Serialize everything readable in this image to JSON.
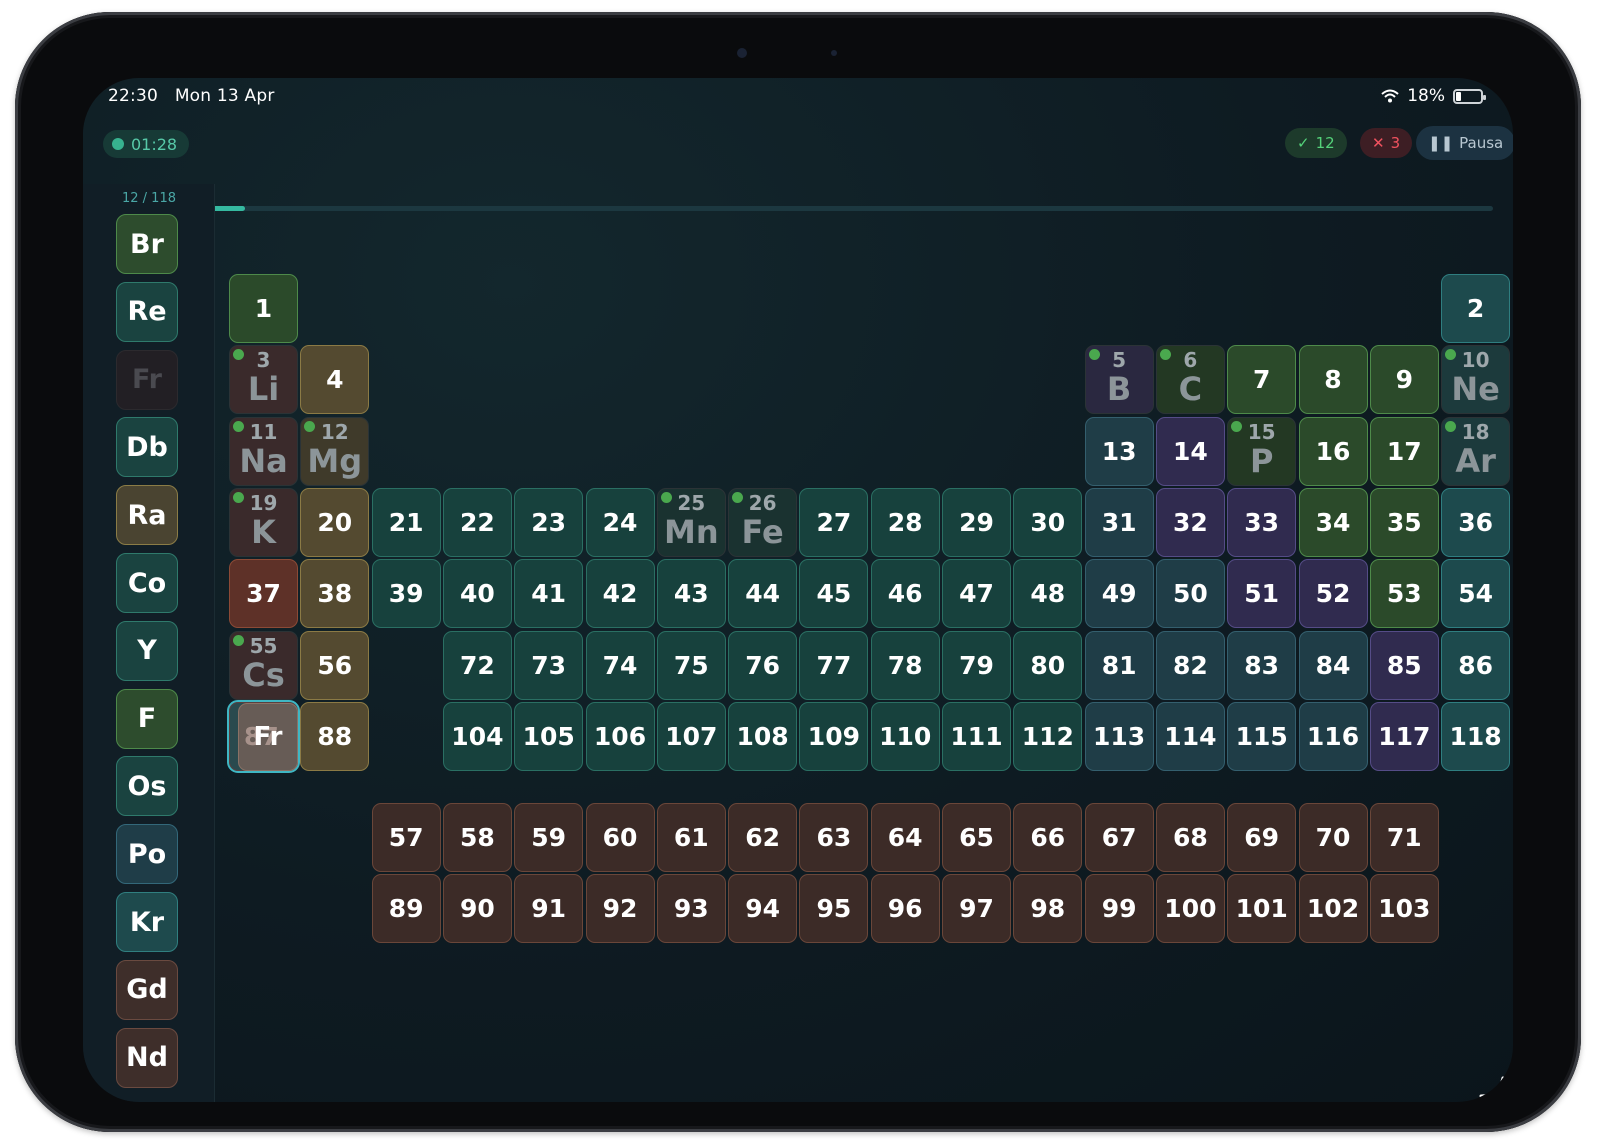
{
  "status": {
    "time": "22:30",
    "date": "Mon 13 Apr",
    "battery": "18%"
  },
  "topbar": {
    "timer": "01:28",
    "correct": "12",
    "wrong": "3",
    "pause_label": "Pausa",
    "progress": 0.102
  },
  "sidebar": {
    "count": "12 / 118",
    "items": [
      "Br",
      "Re",
      "Fr",
      "Db",
      "Ra",
      "Co",
      "Y",
      "F",
      "Os",
      "Po",
      "Kr",
      "Gd",
      "Nd"
    ]
  },
  "dragging": {
    "symbol": "Fr",
    "under_number": "87"
  },
  "colors": {
    "alkali": "#3a2a2b",
    "alkaline": "#5a5132",
    "transition": "#173f3c",
    "metalloid": "#332e52",
    "nonmetal": "#2b4a2a",
    "noble": "#1d4649",
    "post": "#1f3d48",
    "lanthanide": "#3d2a26",
    "halogen": "#2b4a2a",
    "actinide_alkali": "#67352c",
    "h": "#2b4a2a"
  },
  "placed": [
    {
      "n": "3",
      "s": "Li"
    },
    {
      "n": "5",
      "s": "B"
    },
    {
      "n": "6",
      "s": "C"
    },
    {
      "n": "10",
      "s": "Ne"
    },
    {
      "n": "11",
      "s": "Na"
    },
    {
      "n": "12",
      "s": "Mg"
    },
    {
      "n": "15",
      "s": "P"
    },
    {
      "n": "18",
      "s": "Ar"
    },
    {
      "n": "19",
      "s": "K"
    },
    {
      "n": "25",
      "s": "Mn"
    },
    {
      "n": "26",
      "s": "Fe"
    },
    {
      "n": "55",
      "s": "Cs"
    }
  ]
}
